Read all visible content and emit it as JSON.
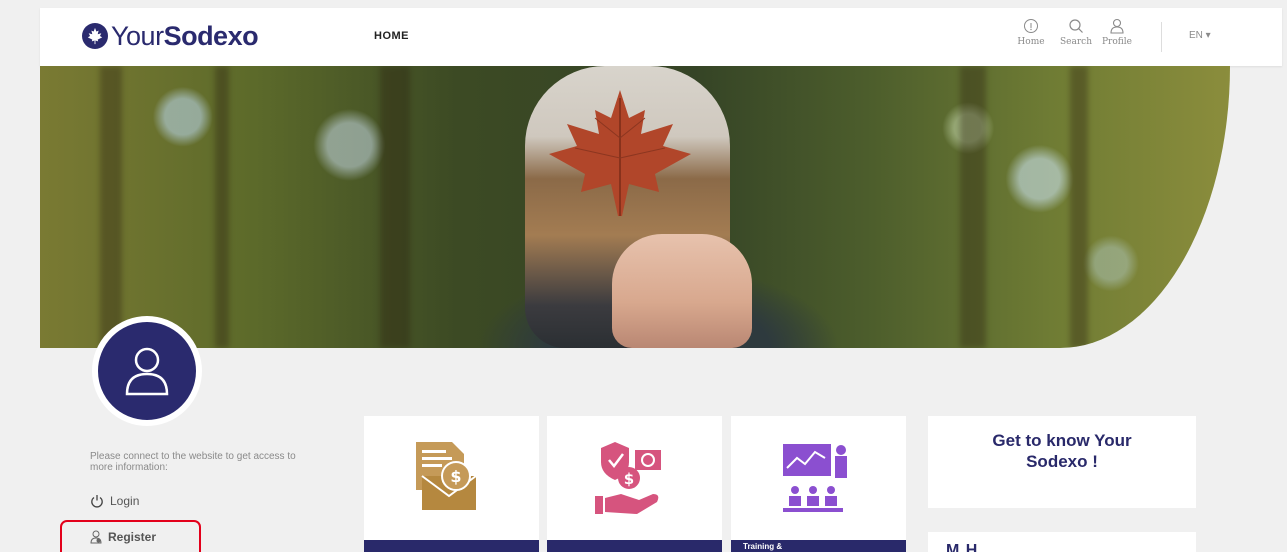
{
  "header": {
    "logo_light": "Your",
    "logo_bold": "Sodexo",
    "nav_home": "HOME",
    "icons": [
      {
        "name": "home-icon",
        "label": "Home"
      },
      {
        "name": "search-icon",
        "label": "Search"
      },
      {
        "name": "profile-icon",
        "label": "Profile"
      }
    ],
    "language": "EN ▾"
  },
  "sidebar": {
    "connect_text": "Please connect to the website to get access to more information:",
    "login_label": "Login",
    "register_label": "Register"
  },
  "tiles": [
    {
      "icon": "envelope-dollar-icon",
      "bar_label": ""
    },
    {
      "icon": "hand-coins-icon",
      "bar_label": ""
    },
    {
      "icon": "training-presentation-icon",
      "bar_label": "Training &"
    }
  ],
  "cards": {
    "get_to_know": "Get to know Your Sodexo !",
    "second_partial": "M         H"
  },
  "colors": {
    "brand": "#29296a",
    "highlight": "#e3001b"
  }
}
